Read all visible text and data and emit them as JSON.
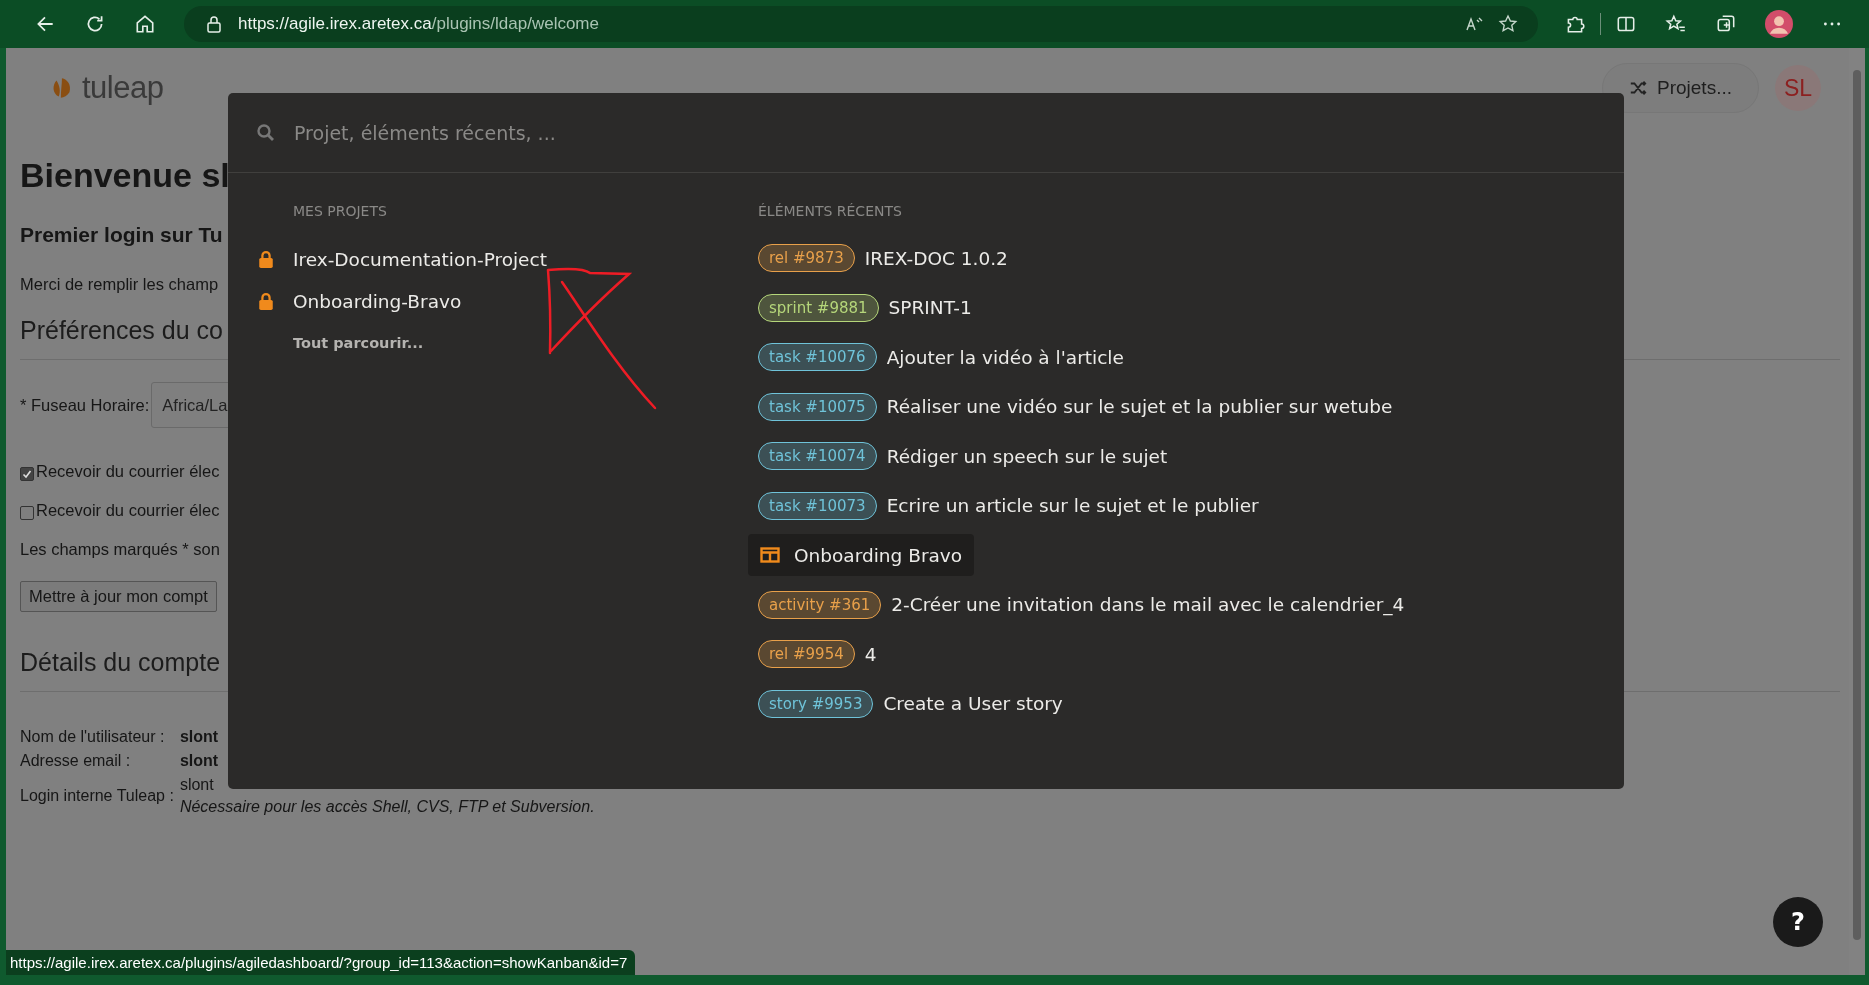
{
  "browser": {
    "url_host": "https://agile.irex.aretex.ca",
    "url_path": "/plugins/ldap/welcome",
    "status_url": "https://agile.irex.aretex.ca/plugins/agiledashboard/?group_id=113&action=showKanban&id=7"
  },
  "header": {
    "logo": "tuleap",
    "projects_button": "Projets...",
    "avatar": "SL"
  },
  "page": {
    "title": "Bienvenue sl",
    "subtitle": "Premier login sur Tu",
    "intro": "Merci de remplir les champ",
    "prefs_heading": "Préférences du co",
    "timezone_label": "* Fuseau Horaire:",
    "timezone_value": "Africa/La",
    "checkboxes": [
      {
        "label": "Recevoir du courrier élec",
        "checked": true
      },
      {
        "label": "Recevoir du courrier élec",
        "checked": false
      }
    ],
    "required_note": "Les champs marqués * son",
    "update_button": "Mettre à jour mon compt",
    "details_heading": "Détails du compte",
    "details": [
      {
        "label": "Nom de l'utilisateur :",
        "value": "slont",
        "bold": true
      },
      {
        "label": "Adresse email :",
        "value": "slont",
        "bold": true
      },
      {
        "label": "Login interne Tuleap :",
        "value": "slont",
        "bold": false,
        "note": "Nécessaire pour les accès Shell, CVS, FTP et Subversion."
      }
    ]
  },
  "switcher": {
    "search_placeholder": "Projet, éléments récents, ...",
    "projects_heading": "MES PROJETS",
    "projects": [
      {
        "name": "Irex-Documentation-Project",
        "private": true
      },
      {
        "name": "Onboarding-Bravo",
        "private": true
      }
    ],
    "browse_all": "Tout parcourir...",
    "recent_heading": "ÉLÉMENTS RÉCENTS",
    "recent": [
      {
        "kind": "artifact",
        "badge": "rel #9873",
        "color": "#e8a04a",
        "title": "IREX-DOC 1.0.2",
        "selected": false
      },
      {
        "kind": "artifact",
        "badge": "sprint #9881",
        "color": "#b5d67a",
        "title": "SPRINT-1",
        "selected": false
      },
      {
        "kind": "artifact",
        "badge": "task #10076",
        "color": "#6fc3d9",
        "title": "Ajouter la vidéo à l'article",
        "selected": false
      },
      {
        "kind": "artifact",
        "badge": "task #10075",
        "color": "#6fc3d9",
        "title": "Réaliser une vidéo sur le sujet et la publier sur wetube",
        "selected": false
      },
      {
        "kind": "artifact",
        "badge": "task #10074",
        "color": "#6fc3d9",
        "title": "Rédiger un speech sur le sujet",
        "selected": false
      },
      {
        "kind": "artifact",
        "badge": "task #10073",
        "color": "#6fc3d9",
        "title": "Ecrire un article sur le sujet et le publier",
        "selected": false
      },
      {
        "kind": "kanban",
        "title": "Onboarding Bravo",
        "selected": true
      },
      {
        "kind": "artifact",
        "badge": "activity #361",
        "color": "#e8a04a",
        "title": "2-Créer une invitation dans le mail avec le calendrier_4",
        "selected": false
      },
      {
        "kind": "artifact",
        "badge": "rel #9954",
        "color": "#e8a04a",
        "title": "4",
        "selected": false
      },
      {
        "kind": "artifact",
        "badge": "story #9953",
        "color": "#6fc3d9",
        "title": "Create a User story",
        "selected": false
      }
    ]
  },
  "help_button": "?"
}
